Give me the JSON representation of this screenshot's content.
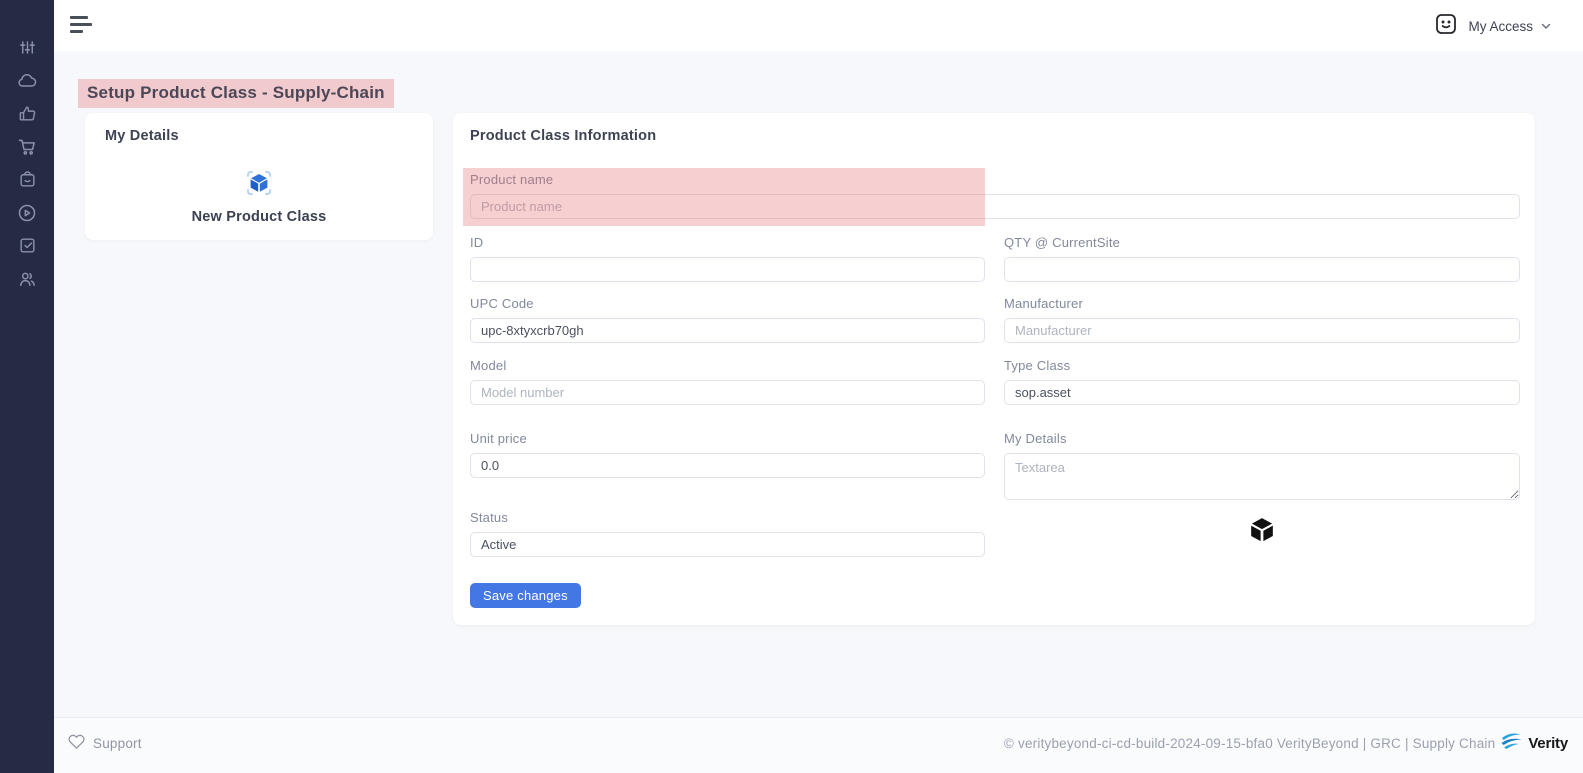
{
  "colors": {
    "sidebar_bg": "#262b45",
    "accent_blue": "#4377e4",
    "highlight_pink": "rgba(226,106,110,0.32)",
    "cube_blue": "#2b6fd6",
    "content_bg": "#f7f8fb"
  },
  "sidebar": {
    "icons": [
      {
        "name": "sliders"
      },
      {
        "name": "cloud"
      },
      {
        "name": "thumbs-up"
      },
      {
        "name": "shopping-cart"
      },
      {
        "name": "shopping-bag"
      },
      {
        "name": "play-circle"
      },
      {
        "name": "check-square"
      },
      {
        "name": "users"
      }
    ]
  },
  "navbar": {
    "my_access_label": "My Access"
  },
  "page": {
    "title": "Setup Product Class - Supply-Chain"
  },
  "my_details_card": {
    "title": "My Details",
    "new_product_class_label": "New Product Class"
  },
  "form": {
    "title": "Product Class Information",
    "fields": {
      "product_name": {
        "label": "Product name",
        "placeholder": "Product name",
        "value": ""
      },
      "id": {
        "label": "ID",
        "value": ""
      },
      "qty": {
        "label": "QTY @ CurrentSite",
        "value": ""
      },
      "upc": {
        "label": "UPC Code",
        "value": "upc-8xtyxcrb70gh"
      },
      "manufacturer": {
        "label": "Manufacturer",
        "placeholder": "Manufacturer",
        "value": ""
      },
      "model": {
        "label": "Model",
        "placeholder": "Model number",
        "value": ""
      },
      "type_class": {
        "label": "Type Class",
        "value": "sop.asset"
      },
      "unit_price": {
        "label": "Unit price",
        "value": "0.0"
      },
      "my_details": {
        "label": "My Details",
        "placeholder": "Textarea",
        "value": ""
      },
      "status": {
        "label": "Status",
        "value": "Active"
      }
    },
    "save_button_label": "Save changes"
  },
  "footer": {
    "support_label": "Support",
    "copyright": "© veritybeyond-ci-cd-build-2024-09-15-bfa0 VerityBeyond | GRC | Supply Chain",
    "brand": "Verity"
  }
}
